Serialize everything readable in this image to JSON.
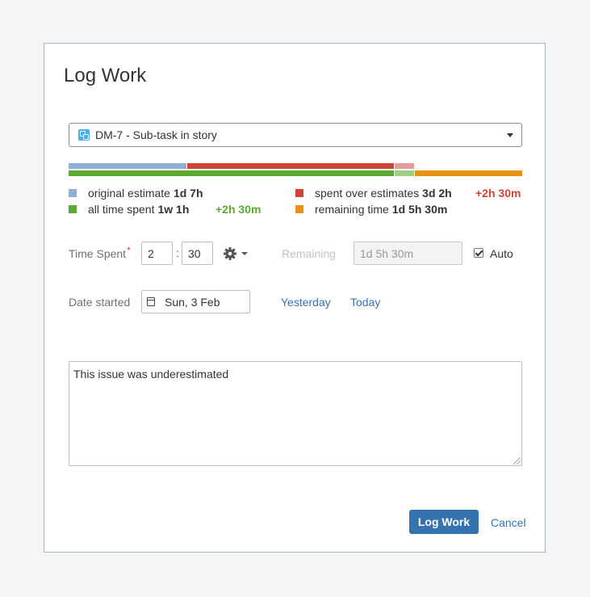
{
  "dialog": {
    "title": "Log Work"
  },
  "issue": {
    "selected": "DM-7 - Sub-task in story",
    "icon": "subtask-icon"
  },
  "progress": {
    "original_pct": 0.26,
    "spent_over_pct": 0.715,
    "colors": {
      "original": "#8eb0d7",
      "spent_over": "#d04437",
      "spent_over_light": "#e59d97",
      "all_time": "#5aaa2e",
      "all_time_light": "#9ccf86",
      "remaining": "#ea9012"
    }
  },
  "legend": {
    "original_label": "original estimate",
    "original_value": "1d 7h",
    "spent_over_label": "spent over estimates",
    "spent_over_value": "3d 2h",
    "spent_over_delta": "+2h 30m",
    "all_time_label": "all time spent",
    "all_time_value": "1w 1h",
    "all_time_delta": "+2h 30m",
    "remaining_label": "remaining time",
    "remaining_value": "1d 5h 30m"
  },
  "time_spent": {
    "label": "Time Spent",
    "required": "*",
    "hours": "2",
    "separator": ":",
    "minutes": "30",
    "settings_icon": "gear-icon"
  },
  "remaining": {
    "label": "Remaining",
    "value": "1d 5h 30m",
    "auto_label": "Auto",
    "auto_checked": true
  },
  "date_started": {
    "label": "Date started",
    "value": "Sun, 3 Feb",
    "yesterday": "Yesterday",
    "today": "Today"
  },
  "comment": {
    "value": "This issue was underestimated"
  },
  "footer": {
    "submit": "Log Work",
    "cancel": "Cancel"
  }
}
